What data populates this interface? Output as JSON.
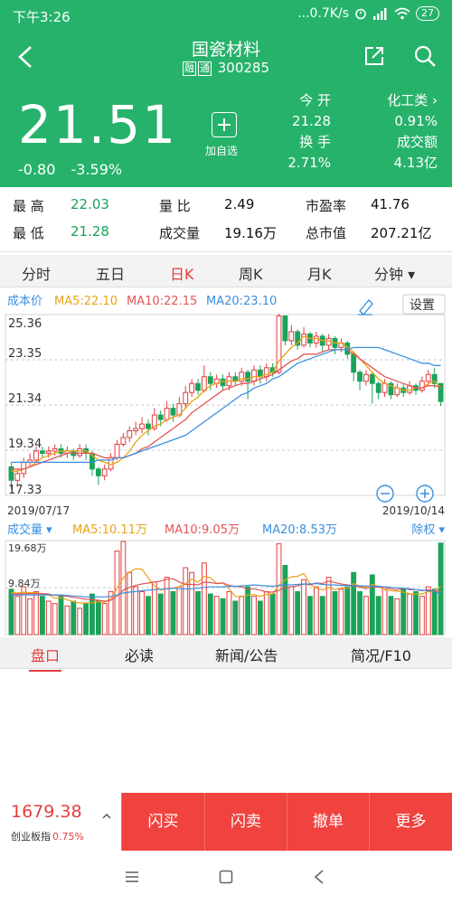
{
  "status_bar": {
    "time": "下午3:26",
    "network": "...0.7K/s",
    "battery": "27"
  },
  "header": {
    "title": "国瓷材料",
    "tag_rong": "融",
    "tag_tong": "通",
    "code": "300285"
  },
  "quote": {
    "price": "21.51",
    "change": "-0.80",
    "change_pct": "-3.59%",
    "add_fav_label": "加自选",
    "open_label": "今 开",
    "open_value": "21.28",
    "turnover_label": "换 手",
    "turnover_value": "2.71%",
    "sector_label": "化工类 ›",
    "sector_change": "0.91%",
    "volume_amount_label": "成交额",
    "volume_amount_value": "4.13亿"
  },
  "stats": {
    "high_label": "最 高",
    "high_value": "22.03",
    "vol_ratio_label": "量 比",
    "vol_ratio_value": "2.49",
    "pe_label": "市盈率",
    "pe_value": "41.76",
    "low_label": "最 低",
    "low_value": "21.28",
    "volume_label": "成交量",
    "volume_value": "19.16万",
    "mktcap_label": "总市值",
    "mktcap_value": "207.21亿"
  },
  "kline_tabs": [
    {
      "label": "分时"
    },
    {
      "label": "五日"
    },
    {
      "label": "日K"
    },
    {
      "label": "周K"
    },
    {
      "label": "月K"
    },
    {
      "label": "分钟 ▾"
    }
  ],
  "active_kline_tab": "日K",
  "price_chart": {
    "cost_label": "成本价",
    "settings_label": "设置",
    "ma5": "MA5:22.10",
    "ma10": "MA10:22.15",
    "ma20": "MA20:23.10",
    "y_ticks": [
      "25.36",
      "23.35",
      "21.34",
      "19.34",
      "17.33"
    ],
    "date_start": "2019/07/17",
    "date_end": "2019/10/14",
    "zoom_out": "−",
    "zoom_in": "+"
  },
  "volume_chart": {
    "label": "成交量 ▾",
    "ma5": "MA5:10.11万",
    "ma10": "MA10:9.05万",
    "ma20": "MA20:8.53万",
    "rights": "除权 ▾",
    "y_ticks": [
      "19.68万",
      "9.84万"
    ]
  },
  "chart_data": {
    "type": "candlestick",
    "title": "",
    "ylim": [
      17.33,
      25.36
    ],
    "x_range": [
      "2019/07/17",
      "2019/10/14"
    ],
    "candles": [
      [
        18.6,
        18.0,
        18.8,
        17.6
      ],
      [
        18.0,
        18.3,
        18.5,
        17.7
      ],
      [
        18.3,
        18.8,
        19.0,
        18.1
      ],
      [
        18.8,
        18.9,
        19.2,
        18.6
      ],
      [
        18.9,
        19.3,
        19.5,
        18.8
      ],
      [
        19.3,
        19.2,
        19.5,
        19.0
      ],
      [
        19.2,
        19.3,
        19.5,
        19.0
      ],
      [
        19.3,
        19.4,
        19.6,
        19.1
      ],
      [
        19.4,
        19.2,
        19.6,
        19.0
      ],
      [
        19.2,
        19.3,
        19.5,
        19.0
      ],
      [
        19.3,
        19.1,
        19.4,
        18.9
      ],
      [
        19.1,
        19.4,
        19.6,
        19.0
      ],
      [
        19.4,
        19.2,
        19.6,
        18.9
      ],
      [
        19.2,
        18.5,
        19.3,
        18.2
      ],
      [
        18.5,
        18.2,
        18.6,
        17.8
      ],
      [
        18.2,
        18.5,
        18.7,
        18.0
      ],
      [
        18.5,
        19.0,
        19.2,
        18.4
      ],
      [
        19.0,
        19.6,
        19.8,
        18.9
      ],
      [
        19.6,
        19.9,
        20.1,
        19.5
      ],
      [
        19.9,
        20.2,
        20.4,
        19.7
      ],
      [
        20.2,
        20.3,
        20.6,
        20.0
      ],
      [
        20.3,
        20.5,
        20.8,
        20.1
      ],
      [
        20.5,
        20.3,
        20.7,
        20.0
      ],
      [
        20.3,
        20.9,
        21.2,
        20.2
      ],
      [
        20.9,
        20.7,
        21.1,
        20.4
      ],
      [
        20.7,
        21.2,
        21.5,
        20.6
      ],
      [
        21.2,
        20.9,
        21.4,
        20.6
      ],
      [
        20.9,
        21.4,
        21.7,
        20.8
      ],
      [
        21.4,
        21.9,
        22.2,
        21.2
      ],
      [
        21.9,
        22.3,
        22.5,
        21.7
      ],
      [
        22.3,
        22.0,
        22.5,
        21.8
      ],
      [
        22.0,
        22.6,
        23.1,
        21.9
      ],
      [
        22.6,
        22.3,
        22.8,
        22.0
      ],
      [
        22.3,
        22.5,
        22.7,
        22.1
      ],
      [
        22.5,
        22.2,
        22.7,
        22.0
      ],
      [
        22.2,
        22.6,
        22.8,
        22.0
      ],
      [
        22.6,
        22.4,
        22.8,
        22.2
      ],
      [
        22.4,
        22.8,
        23.0,
        22.2
      ],
      [
        22.8,
        22.4,
        22.9,
        21.6
      ],
      [
        22.4,
        22.9,
        23.1,
        22.2
      ],
      [
        22.9,
        22.6,
        23.1,
        22.3
      ],
      [
        22.6,
        23.0,
        23.2,
        22.4
      ],
      [
        23.0,
        22.8,
        23.2,
        22.6
      ],
      [
        22.8,
        25.3,
        25.4,
        22.7
      ],
      [
        25.3,
        24.2,
        25.3,
        24.0
      ],
      [
        24.2,
        24.6,
        24.9,
        24.0
      ],
      [
        24.6,
        24.0,
        24.7,
        23.8
      ],
      [
        24.0,
        24.5,
        24.8,
        23.9
      ],
      [
        24.5,
        24.1,
        24.6,
        23.9
      ],
      [
        24.1,
        24.4,
        24.6,
        23.9
      ],
      [
        24.4,
        24.0,
        24.5,
        23.7
      ],
      [
        24.0,
        24.3,
        24.5,
        23.8
      ],
      [
        24.3,
        23.9,
        24.4,
        23.6
      ],
      [
        23.9,
        24.1,
        24.3,
        23.7
      ],
      [
        24.1,
        23.6,
        24.2,
        23.4
      ],
      [
        23.6,
        22.8,
        23.7,
        22.4
      ],
      [
        22.8,
        22.4,
        22.9,
        22.0
      ],
      [
        22.4,
        22.7,
        22.9,
        22.2
      ],
      [
        22.7,
        22.3,
        22.8,
        21.4
      ],
      [
        22.3,
        21.9,
        22.4,
        21.6
      ],
      [
        21.9,
        22.3,
        22.5,
        21.7
      ],
      [
        22.3,
        21.8,
        22.4,
        21.6
      ],
      [
        21.8,
        22.1,
        22.3,
        21.7
      ],
      [
        22.1,
        21.9,
        22.3,
        21.7
      ],
      [
        21.9,
        22.2,
        22.4,
        21.8
      ],
      [
        22.2,
        22.0,
        22.3,
        21.8
      ],
      [
        22.0,
        22.4,
        22.6,
        21.9
      ],
      [
        22.4,
        22.7,
        22.9,
        22.2
      ],
      [
        22.7,
        22.3,
        23.0,
        22.1
      ],
      [
        22.3,
        21.5,
        22.0,
        21.3
      ]
    ],
    "ma5": [
      18.4,
      18.4,
      18.5,
      18.6,
      18.8,
      19.0,
      19.1,
      19.2,
      19.3,
      19.3,
      19.3,
      19.3,
      19.3,
      19.1,
      18.9,
      18.8,
      18.7,
      18.8,
      19.0,
      19.3,
      19.7,
      20.0,
      20.2,
      20.4,
      20.5,
      20.7,
      20.8,
      20.9,
      21.2,
      21.5,
      21.7,
      22.0,
      22.2,
      22.3,
      22.4,
      22.4,
      22.4,
      22.5,
      22.5,
      22.6,
      22.6,
      22.7,
      22.8,
      23.3,
      23.6,
      23.9,
      24.1,
      24.4,
      24.3,
      24.3,
      24.2,
      24.2,
      24.1,
      24.1,
      23.9,
      23.7,
      23.4,
      23.1,
      22.8,
      22.5,
      22.3,
      22.2,
      22.1,
      22.0,
      22.0,
      22.1,
      22.1,
      22.3,
      22.4,
      22.1
    ],
    "ma10": [
      18.5,
      18.5,
      18.5,
      18.6,
      18.7,
      18.8,
      18.9,
      19.0,
      19.1,
      19.2,
      19.2,
      19.2,
      19.2,
      19.2,
      19.1,
      19.0,
      19.0,
      19.0,
      19.0,
      19.1,
      19.2,
      19.4,
      19.5,
      19.7,
      19.9,
      20.1,
      20.3,
      20.5,
      20.7,
      21.0,
      21.2,
      21.4,
      21.6,
      21.8,
      22.0,
      22.1,
      22.2,
      22.3,
      22.3,
      22.4,
      22.5,
      22.6,
      22.7,
      22.9,
      23.1,
      23.3,
      23.4,
      23.6,
      23.6,
      23.6,
      23.7,
      23.8,
      23.8,
      23.8,
      23.8,
      23.6,
      23.4,
      23.2,
      23.0,
      22.8,
      22.6,
      22.5,
      22.4,
      22.3,
      22.2,
      22.1,
      22.1,
      22.2,
      22.2,
      22.15
    ],
    "ma20": [
      18.8,
      18.8,
      18.8,
      18.8,
      18.8,
      18.8,
      18.8,
      18.8,
      18.8,
      18.8,
      18.8,
      18.8,
      18.8,
      18.8,
      18.9,
      18.9,
      18.9,
      19.0,
      19.0,
      19.1,
      19.2,
      19.3,
      19.4,
      19.5,
      19.6,
      19.7,
      19.8,
      19.9,
      20.0,
      20.2,
      20.4,
      20.6,
      20.8,
      21.0,
      21.2,
      21.4,
      21.6,
      21.8,
      21.9,
      22.1,
      22.2,
      22.3,
      22.5,
      22.6,
      22.8,
      23.0,
      23.2,
      23.3,
      23.4,
      23.5,
      23.6,
      23.7,
      23.8,
      23.8,
      23.8,
      23.9,
      23.9,
      23.9,
      23.9,
      23.9,
      23.8,
      23.7,
      23.6,
      23.5,
      23.4,
      23.3,
      23.2,
      23.2,
      23.1,
      23.1
    ],
    "volume_ylim": [
      0,
      19.68
    ],
    "volume_unit": "万",
    "volumes": [
      9.5,
      8.0,
      10.0,
      7.5,
      9.0,
      8.0,
      7.0,
      6.5,
      8.0,
      6.0,
      7.0,
      5.5,
      6.5,
      8.5,
      7.0,
      6.5,
      9.0,
      17.5,
      19.5,
      13.0,
      10.0,
      9.0,
      8.0,
      11.0,
      8.5,
      12.0,
      9.0,
      10.0,
      14.0,
      13.0,
      9.0,
      15.0,
      8.5,
      8.0,
      7.5,
      9.0,
      7.0,
      8.0,
      10.0,
      8.0,
      7.0,
      9.0,
      8.5,
      19.0,
      14.5,
      10.0,
      9.0,
      11.5,
      8.0,
      10.0,
      8.0,
      12.0,
      9.0,
      9.5,
      10.0,
      13.0,
      9.0,
      8.0,
      12.5,
      8.0,
      9.5,
      8.0,
      7.5,
      9.5,
      8.5,
      9.0,
      8.0,
      10.0,
      9.5,
      19.16
    ],
    "vol_ma5": [
      8.8,
      8.7,
      8.9,
      8.8,
      8.8,
      8.5,
      8.3,
      7.6,
      7.7,
      7.3,
      6.9,
      6.6,
      6.6,
      6.7,
      6.9,
      6.8,
      7.5,
      9.7,
      11.9,
      13.1,
      13.8,
      13.7,
      11.9,
      10.2,
      9.3,
      9.7,
      9.7,
      10.1,
      10.7,
      11.6,
      11.0,
      12.2,
      11.9,
      10.7,
      10.8,
      9.6,
      8.0,
      7.9,
      8.3,
      8.4,
      8.0,
      8.4,
      8.5,
      10.3,
      11.5,
      12.1,
      12.2,
      12.8,
      10.6,
      9.7,
      9.3,
      9.9,
      9.4,
      9.7,
      9.7,
      10.7,
      10.1,
      9.9,
      10.5,
      10.1,
      9.4,
      9.2,
      9.1,
      8.9,
      8.6,
      8.5,
      8.5,
      9.0,
      9.1,
      10.11
    ],
    "vol_ma10": [
      8.5,
      8.5,
      8.6,
      8.6,
      8.6,
      8.6,
      8.5,
      8.2,
      8.2,
      8.0,
      7.8,
      7.6,
      7.4,
      7.3,
      7.2,
      7.0,
      7.2,
      8.1,
      9.3,
      9.9,
      10.3,
      10.6,
      10.8,
      11.0,
      11.2,
      11.6,
      11.7,
      11.0,
      10.5,
      10.5,
      10.4,
      11.0,
      10.9,
      10.7,
      10.8,
      10.3,
      10.1,
      10.0,
      9.5,
      9.6,
      9.3,
      8.9,
      8.9,
      9.3,
      9.9,
      10.0,
      10.2,
      10.6,
      10.4,
      10.8,
      10.7,
      11.2,
      10.9,
      10.6,
      10.4,
      10.2,
      10.0,
      9.6,
      10.0,
      9.9,
      9.9,
      9.6,
      9.4,
      9.7,
      9.4,
      9.4,
      9.2,
      9.4,
      9.1,
      9.05
    ],
    "vol_ma20": [
      8.3,
      8.3,
      8.3,
      8.3,
      8.3,
      8.3,
      8.3,
      8.3,
      8.3,
      8.2,
      8.1,
      8.0,
      7.9,
      7.9,
      7.9,
      7.9,
      8.0,
      8.3,
      8.7,
      8.9,
      9.0,
      9.2,
      9.3,
      9.4,
      9.5,
      9.6,
      9.7,
      9.6,
      9.6,
      9.6,
      9.7,
      9.9,
      10.0,
      10.0,
      10.0,
      10.1,
      10.1,
      10.2,
      10.3,
      10.4,
      10.3,
      10.2,
      10.1,
      10.3,
      10.4,
      10.4,
      10.5,
      10.6,
      10.6,
      10.7,
      10.5,
      10.4,
      10.4,
      10.3,
      10.3,
      10.3,
      10.2,
      10.2,
      10.1,
      10.1,
      10.0,
      9.9,
      9.8,
      9.7,
      9.6,
      9.4,
      9.3,
      9.2,
      9.0,
      8.53
    ],
    "colors": {
      "up": "#e23d3d",
      "down": "#1ba35a",
      "ma5": "#e8a317",
      "ma10": "#e25555",
      "ma20": "#3b8fe0"
    }
  },
  "bottom_tabs": [
    {
      "label": "盘口"
    },
    {
      "label": "必读"
    },
    {
      "label": "新闻/公告"
    },
    {
      "label": "简况/F10"
    }
  ],
  "index_bar": {
    "value": "1679.38",
    "name": "创业板指",
    "pct": "0.75%"
  },
  "trade_buttons": [
    {
      "label": "闪买"
    },
    {
      "label": "闪卖"
    },
    {
      "label": "撤单"
    },
    {
      "label": "更多"
    }
  ],
  "colors": {
    "brand_green": "#27b26b",
    "up_red": "#e23d3d",
    "trade_red": "#f0433f"
  }
}
